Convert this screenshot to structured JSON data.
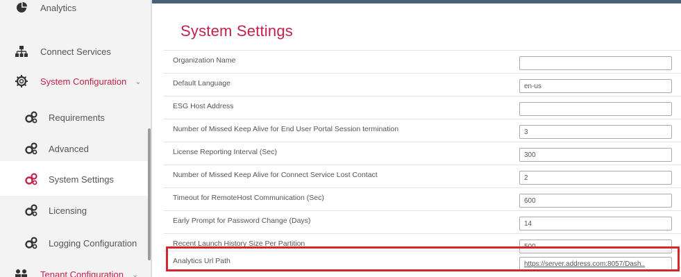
{
  "sidebar": {
    "items": [
      {
        "label": "Analytics",
        "icon": "pie-chart-icon"
      },
      {
        "label": "Connect Services",
        "icon": "network-icon"
      },
      {
        "label": "System Configuration",
        "icon": "gear-icon",
        "expanded": true
      },
      {
        "label": "Requirements",
        "icon": "gears-icon"
      },
      {
        "label": "Advanced",
        "icon": "gears-icon"
      },
      {
        "label": "System Settings",
        "icon": "gears-icon",
        "selected": true
      },
      {
        "label": "Licensing",
        "icon": "gears-icon"
      },
      {
        "label": "Logging Configuration",
        "icon": "gears-icon"
      },
      {
        "label": "Tenant Configuration",
        "icon": "users-icon"
      }
    ]
  },
  "page": {
    "title": "System Settings"
  },
  "settings": [
    {
      "label": "Organization Name",
      "value": ""
    },
    {
      "label": "Default Language",
      "value": "en-us"
    },
    {
      "label": "ESG Host Address",
      "value": ""
    },
    {
      "label": "Number of Missed Keep Alive for End User Portal Session termination",
      "value": "3"
    },
    {
      "label": "License Reporting Interval (Sec)",
      "value": "300"
    },
    {
      "label": "Number of Missed Keep Alive for Connect Service Lost Contact",
      "value": "2"
    },
    {
      "label": "Timeout for RemoteHost Communication (Sec)",
      "value": "600"
    },
    {
      "label": "Early Prompt for Password Change (Days)",
      "value": "14"
    },
    {
      "label": "Recent Launch History Size Per Partition",
      "value": "500"
    },
    {
      "label": "Analytics Url Path",
      "value": "https://server.address.com:8057/Dash.."
    }
  ],
  "colors": {
    "accent": "#c3224b",
    "highlight": "#d6262d",
    "topbar": "#4a5f7a"
  }
}
